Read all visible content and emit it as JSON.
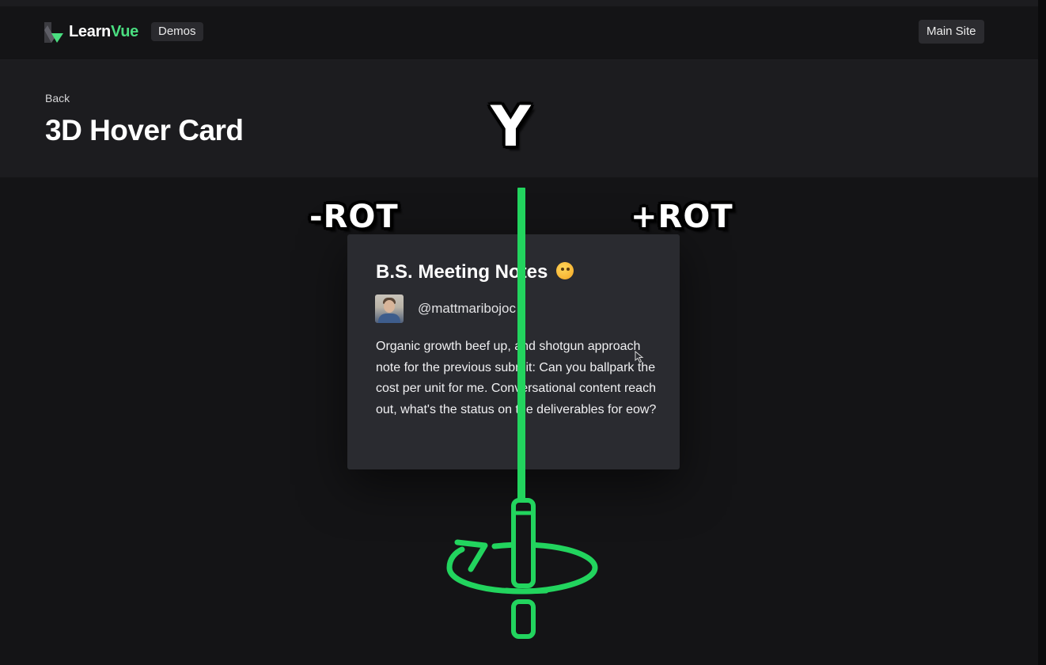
{
  "nav": {
    "logo_learn": "Learn",
    "logo_vue": "Vue",
    "demos_badge": "Demos",
    "main_site_label": "Main Site"
  },
  "header": {
    "back_label": "Back",
    "title": "3D Hover Card"
  },
  "card": {
    "title": "B.S. Meeting Notes",
    "emoji_icon": "woozy-face-emoji",
    "handle": "@mattmaribojoc",
    "body": "Organic growth beef up, and shotgun approach note for the previous submit: Can you ballpark the cost per unit for me. Conversational content reach out, what's the status on the deliverables for eow?"
  },
  "overlay": {
    "axis_label": "Y",
    "negative_label": "-ROT",
    "positive_label": "+ROT",
    "axis_color": "#22d45e",
    "rotation_icon": "rotation-arrow-icon"
  },
  "colors": {
    "accent": "#4ade80",
    "background": "#141416",
    "header_band": "#1c1c1f",
    "card": "#2a2b30"
  }
}
